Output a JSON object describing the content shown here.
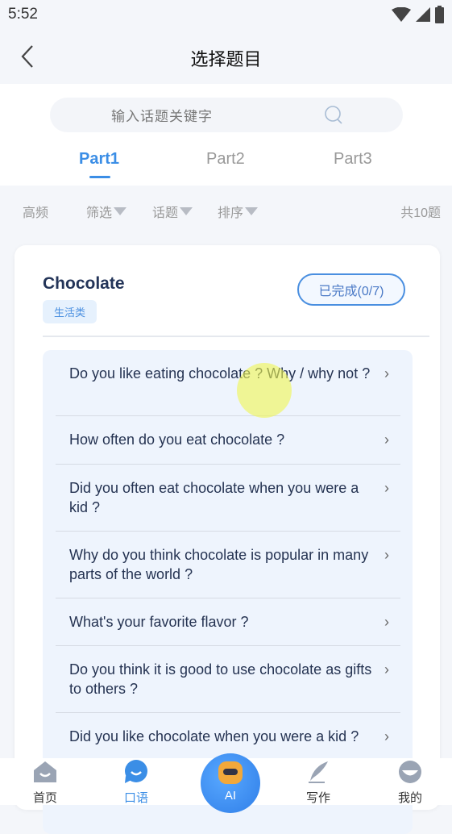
{
  "status": {
    "time": "5:52"
  },
  "header": {
    "title": "选择题目"
  },
  "search": {
    "placeholder": "输入话题关键字"
  },
  "tabs": [
    {
      "label": "Part1",
      "active": true
    },
    {
      "label": "Part2"
    },
    {
      "label": "Part3"
    }
  ],
  "filters": {
    "hot": "高频",
    "filter": "筛选",
    "topic": "话题",
    "sort": "排序",
    "count": "共10题"
  },
  "card": {
    "title": "Chocolate",
    "tag": "生活类",
    "progress": "已完成(0/7)",
    "questions": [
      "Do you like eating chocolate ? Why / why not ?",
      "How often do you eat chocolate ?",
      "Did you often eat chocolate when you were a kid ?",
      "Why do you think chocolate is popular in many parts of the world ?",
      "What's your favorite flavor ?",
      "Do you think it is good to use chocolate as gifts to others ?",
      "Did you like chocolate when you were a kid ?"
    ]
  },
  "nav": {
    "home": "首页",
    "speaking": "口语",
    "ai": "AI",
    "writing": "写作",
    "mine": "我的",
    "active": "speaking"
  },
  "colors": {
    "accent": "#3b8ee6",
    "title": "#233458",
    "list_bg": "#eef4fd"
  }
}
